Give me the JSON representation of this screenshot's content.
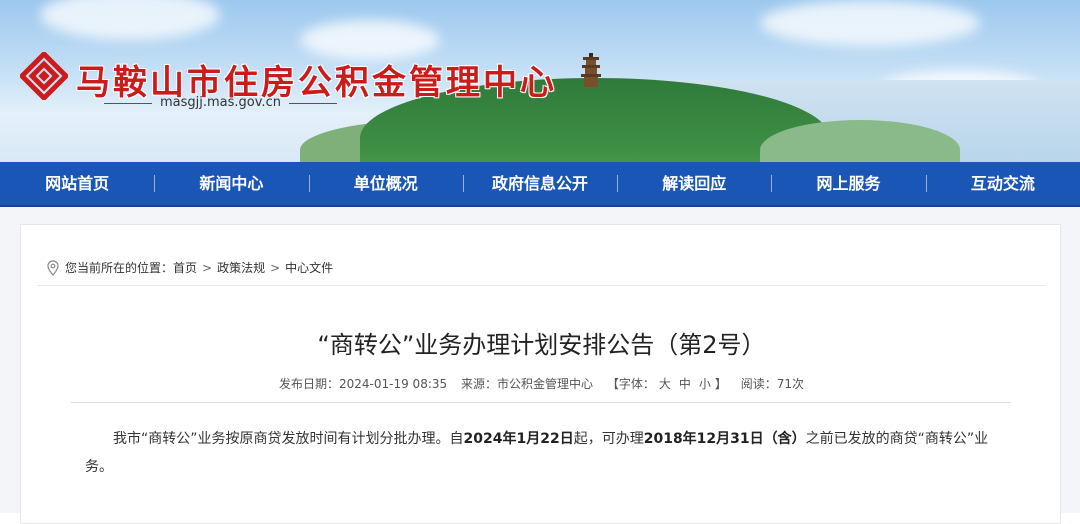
{
  "header": {
    "site_title": "马鞍山市住房公积金管理中心",
    "site_domain": "masgjj.mas.gov.cn",
    "logo_icon": "housing-fund-logo-icon",
    "brand_red": "#cc1b1b"
  },
  "nav": {
    "color": "#1a56b5",
    "items": [
      {
        "label": "网站首页"
      },
      {
        "label": "新闻中心"
      },
      {
        "label": "单位概况"
      },
      {
        "label": "政府信息公开"
      },
      {
        "label": "解读回应"
      },
      {
        "label": "网上服务"
      },
      {
        "label": "互动交流"
      }
    ]
  },
  "breadcrumb": {
    "icon": "location-pin-icon",
    "prefix": "您当前所在的位置：",
    "items": [
      "首页",
      "政策法规",
      "中心文件"
    ],
    "separator": ">"
  },
  "article": {
    "title": "“商转公”业务办理计划安排公告（第2号）",
    "meta": {
      "publish_date": "发布日期：2024-01-19 08:35",
      "source": "来源：市公积金管理中心",
      "font_size_label": "【字体：",
      "font_large": "大",
      "font_medium": "中",
      "font_small": "小",
      "font_size_close": "】",
      "views": "阅读：71次"
    },
    "body": {
      "part1": "我市“商转公”业务按原商贷发放时间有计划分批办理。自",
      "bold1": "2024年1月22日",
      "part2": "起，可办理",
      "bold2": "2018年12月31日（含）",
      "part3": "之前已发放的商贷“商转公”业务。"
    }
  }
}
